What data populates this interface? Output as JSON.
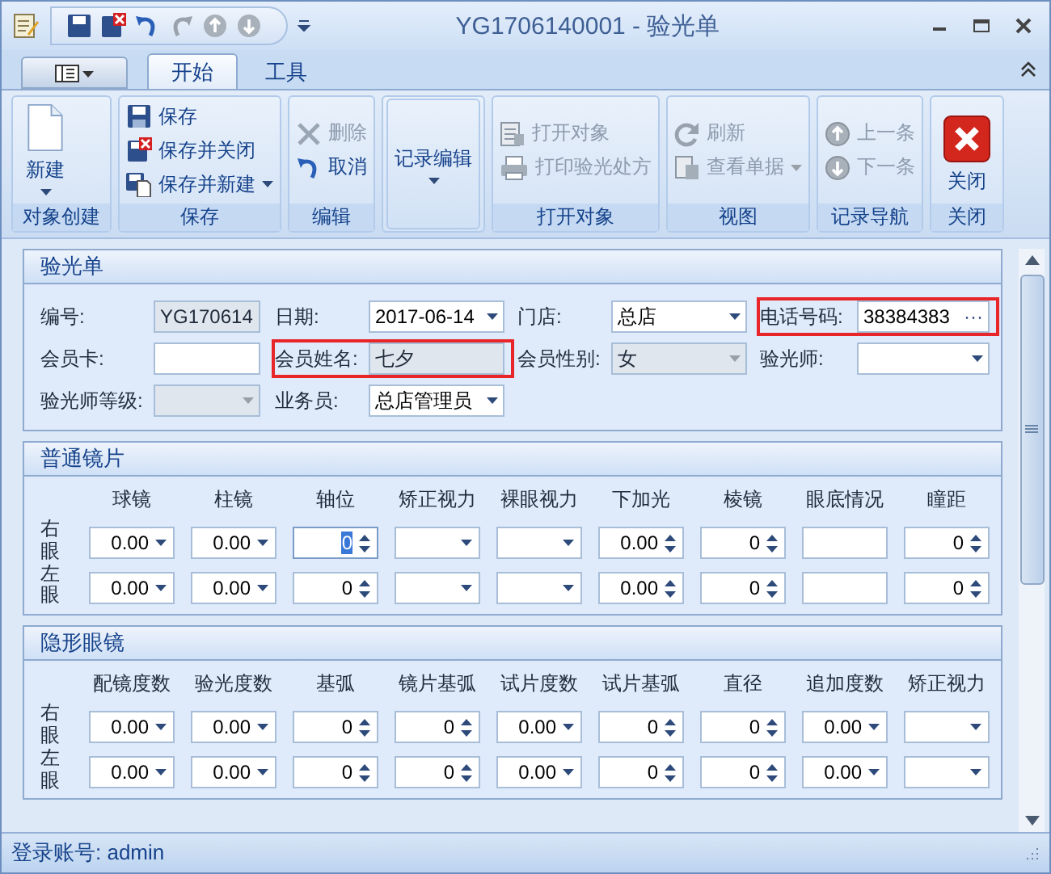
{
  "window": {
    "title": "YG1706140001 - 验光单"
  },
  "tabs": [
    {
      "label": "开始",
      "selected": true
    },
    {
      "label": "工具",
      "selected": false
    }
  ],
  "ribbon_groups": [
    {
      "label": "对象创建",
      "items": [
        {
          "label": "新建",
          "kind": "new",
          "dropdown": true,
          "disabled": false
        }
      ]
    },
    {
      "label": "保存",
      "items": [
        {
          "label": "保存",
          "kind": "save",
          "dropdown": false,
          "disabled": false
        },
        {
          "label": "保存并关闭",
          "kind": "save-close",
          "dropdown": false,
          "disabled": false
        },
        {
          "label": "保存并新建",
          "kind": "save-new",
          "dropdown": true,
          "disabled": false
        }
      ]
    },
    {
      "label": "编辑",
      "items": [
        {
          "label": "删除",
          "kind": "delete",
          "dropdown": false,
          "disabled": true
        },
        {
          "label": "取消",
          "kind": "undo",
          "dropdown": false,
          "disabled": false
        }
      ]
    },
    {
      "items": [
        {
          "label": "记录编辑",
          "kind": "plain",
          "dropdown": true,
          "disabled": false
        }
      ]
    },
    {
      "label": "打开对象",
      "items": [
        {
          "label": "打开对象",
          "kind": "open",
          "dropdown": false,
          "disabled": true
        },
        {
          "label": "打印验光处方",
          "kind": "print",
          "dropdown": false,
          "disabled": true
        }
      ]
    },
    {
      "label": "视图",
      "items": [
        {
          "label": "刷新",
          "kind": "refresh",
          "dropdown": false,
          "disabled": true
        },
        {
          "label": "查看单据",
          "kind": "view",
          "dropdown": true,
          "disabled": true
        }
      ]
    },
    {
      "label": "记录导航",
      "items": [
        {
          "label": "上一条",
          "kind": "up",
          "dropdown": false,
          "disabled": true
        },
        {
          "label": "下一条",
          "kind": "down",
          "dropdown": false,
          "disabled": true
        }
      ]
    },
    {
      "label": "关闭",
      "items": [
        {
          "label": "关闭",
          "kind": "close",
          "dropdown": false,
          "disabled": false
        }
      ]
    }
  ],
  "form": {
    "title": "验光单",
    "rows": [
      [
        {
          "label": "编号:",
          "kind": "text",
          "value": "YG170614",
          "disabled": true,
          "highlighted": false
        },
        {
          "label": "日期:",
          "kind": "combo",
          "value": "2017-06-14",
          "disabled": false,
          "highlighted": false
        },
        {
          "label": "门店:",
          "kind": "combo",
          "value": "总店",
          "disabled": false,
          "highlighted": false
        },
        {
          "label": "电话号码:",
          "kind": "button",
          "value": "38384383",
          "button_text": "···",
          "disabled": false,
          "highlighted": true
        }
      ],
      [
        {
          "label": "会员卡:",
          "kind": "text",
          "disabled": false,
          "highlighted": false
        },
        {
          "label": "会员姓名:",
          "kind": "text",
          "value": "七夕",
          "disabled": true,
          "highlighted": true
        },
        {
          "label": "会员性别:",
          "kind": "combo",
          "value": "女",
          "disabled": true,
          "highlighted": false
        },
        {
          "label": "验光师:",
          "kind": "combo",
          "disabled": false,
          "highlighted": false
        }
      ],
      [
        {
          "label": "验光师等级:",
          "kind": "combo",
          "disabled": true,
          "highlighted": false
        },
        {
          "label": "业务员:",
          "kind": "combo",
          "value": "总店管理员",
          "disabled": false,
          "highlighted": false
        }
      ]
    ]
  },
  "lens_sections": [
    {
      "title": "普通镜片",
      "eye_labels": [
        "右眼",
        "左眼"
      ],
      "columns": [
        {
          "header": "球镜",
          "kind": "combo"
        },
        {
          "header": "柱镜",
          "kind": "combo"
        },
        {
          "header": "轴位",
          "kind": "spin"
        },
        {
          "header": "矫正视力",
          "kind": "combo"
        },
        {
          "header": "裸眼视力",
          "kind": "combo"
        },
        {
          "header": "下加光",
          "kind": "spin"
        },
        {
          "header": "棱镜",
          "kind": "spin"
        },
        {
          "header": "眼底情况",
          "kind": "text"
        },
        {
          "header": "瞳距",
          "kind": "spin"
        }
      ],
      "rows": [
        [
          {
            "value": "0.00",
            "focused": false
          },
          {
            "value": "0.00",
            "focused": false
          },
          {
            "value": "0",
            "focused": true
          },
          {
            "focused": false
          },
          {
            "focused": false
          },
          {
            "value": "0.00",
            "focused": false
          },
          {
            "value": "0",
            "focused": false
          },
          {
            "focused": false
          },
          {
            "value": "0",
            "focused": false
          }
        ],
        [
          {
            "value": "0.00",
            "focused": false
          },
          {
            "value": "0.00",
            "focused": false
          },
          {
            "value": "0",
            "focused": false
          },
          {
            "focused": false
          },
          {
            "focused": false
          },
          {
            "value": "0.00",
            "focused": false
          },
          {
            "value": "0",
            "focused": false
          },
          {
            "focused": false
          },
          {
            "value": "0",
            "focused": false
          }
        ]
      ]
    },
    {
      "title": "隐形眼镜",
      "eye_labels": [
        "右眼",
        "左眼"
      ],
      "columns": [
        {
          "header": "配镜度数",
          "kind": "combo"
        },
        {
          "header": "验光度数",
          "kind": "combo"
        },
        {
          "header": "基弧",
          "kind": "spin"
        },
        {
          "header": "镜片基弧",
          "kind": "spin"
        },
        {
          "header": "试片度数",
          "kind": "combo"
        },
        {
          "header": "试片基弧",
          "kind": "spin"
        },
        {
          "header": "直径",
          "kind": "spin"
        },
        {
          "header": "追加度数",
          "kind": "combo"
        },
        {
          "header": "矫正视力",
          "kind": "combo"
        }
      ],
      "rows": [
        [
          {
            "value": "0.00",
            "focused": false
          },
          {
            "value": "0.00",
            "focused": false
          },
          {
            "value": "0",
            "focused": false
          },
          {
            "value": "0",
            "focused": false
          },
          {
            "value": "0.00",
            "focused": false
          },
          {
            "value": "0",
            "focused": false
          },
          {
            "value": "0",
            "focused": false
          },
          {
            "value": "0.00",
            "focused": false
          },
          {
            "focused": false
          }
        ],
        [
          {
            "value": "0.00",
            "focused": false
          },
          {
            "value": "0.00",
            "focused": false
          },
          {
            "value": "0",
            "focused": false
          },
          {
            "value": "0",
            "focused": false
          },
          {
            "value": "0.00",
            "focused": false
          },
          {
            "value": "0",
            "focused": false
          },
          {
            "value": "0",
            "focused": false
          },
          {
            "value": "0.00",
            "focused": false
          },
          {
            "focused": false
          }
        ]
      ]
    }
  ],
  "status_bar": {
    "text": "登录账号: admin"
  }
}
